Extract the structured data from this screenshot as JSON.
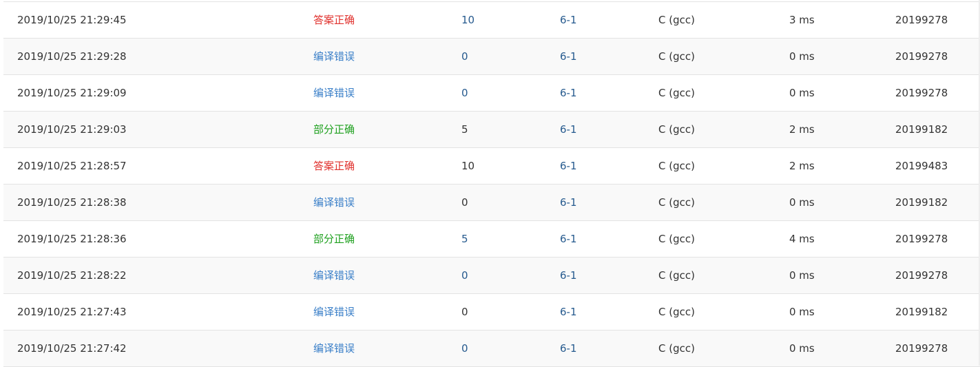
{
  "colors": {
    "accepted": "#e0302c",
    "compile_error": "#3a7fc8",
    "partial": "#1ea01e",
    "link": "#265a8e",
    "row_stripe": "#f9f9f9",
    "border": "#e3e3e3"
  },
  "submissions": [
    {
      "time": "2019/10/25 21:29:45",
      "status": "答案正确",
      "status_kind": "accepted",
      "score": "10",
      "score_link": true,
      "problem": "6-1",
      "compiler": "C (gcc)",
      "runtime": "3 ms",
      "user": "20199278"
    },
    {
      "time": "2019/10/25 21:29:28",
      "status": "编译错误",
      "status_kind": "compile_error",
      "score": "0",
      "score_link": true,
      "problem": "6-1",
      "compiler": "C (gcc)",
      "runtime": "0 ms",
      "user": "20199278"
    },
    {
      "time": "2019/10/25 21:29:09",
      "status": "编译错误",
      "status_kind": "compile_error",
      "score": "0",
      "score_link": true,
      "problem": "6-1",
      "compiler": "C (gcc)",
      "runtime": "0 ms",
      "user": "20199278"
    },
    {
      "time": "2019/10/25 21:29:03",
      "status": "部分正确",
      "status_kind": "partial",
      "score": "5",
      "score_link": false,
      "problem": "6-1",
      "compiler": "C (gcc)",
      "runtime": "2 ms",
      "user": "20199182"
    },
    {
      "time": "2019/10/25 21:28:57",
      "status": "答案正确",
      "status_kind": "accepted",
      "score": "10",
      "score_link": false,
      "problem": "6-1",
      "compiler": "C (gcc)",
      "runtime": "2 ms",
      "user": "20199483"
    },
    {
      "time": "2019/10/25 21:28:38",
      "status": "编译错误",
      "status_kind": "compile_error",
      "score": "0",
      "score_link": false,
      "problem": "6-1",
      "compiler": "C (gcc)",
      "runtime": "0 ms",
      "user": "20199182"
    },
    {
      "time": "2019/10/25 21:28:36",
      "status": "部分正确",
      "status_kind": "partial",
      "score": "5",
      "score_link": true,
      "problem": "6-1",
      "compiler": "C (gcc)",
      "runtime": "4 ms",
      "user": "20199278"
    },
    {
      "time": "2019/10/25 21:28:22",
      "status": "编译错误",
      "status_kind": "compile_error",
      "score": "0",
      "score_link": true,
      "problem": "6-1",
      "compiler": "C (gcc)",
      "runtime": "0 ms",
      "user": "20199278"
    },
    {
      "time": "2019/10/25 21:27:43",
      "status": "编译错误",
      "status_kind": "compile_error",
      "score": "0",
      "score_link": false,
      "problem": "6-1",
      "compiler": "C (gcc)",
      "runtime": "0 ms",
      "user": "20199182"
    },
    {
      "time": "2019/10/25 21:27:42",
      "status": "编译错误",
      "status_kind": "compile_error",
      "score": "0",
      "score_link": true,
      "problem": "6-1",
      "compiler": "C (gcc)",
      "runtime": "0 ms",
      "user": "20199278"
    }
  ]
}
